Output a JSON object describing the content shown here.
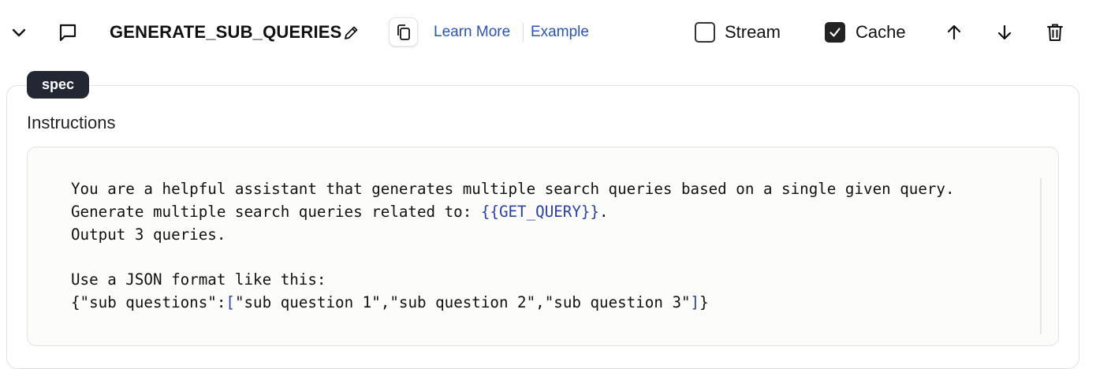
{
  "toolbar": {
    "title": "GENERATE_SUB_QUERIES",
    "learn_more": "Learn More",
    "example": "Example",
    "stream": {
      "label": "Stream",
      "checked": false
    },
    "cache": {
      "label": "Cache",
      "checked": true
    }
  },
  "spec_badge": "spec",
  "instructions": {
    "label": "Instructions",
    "lines": [
      {
        "parts": [
          {
            "text": "You are a helpful assistant that generates multiple search queries based on a single given query.",
            "kind": "plain"
          }
        ]
      },
      {
        "parts": [
          {
            "text": "Generate multiple search queries related to: ",
            "kind": "plain"
          },
          {
            "text": "{{GET_QUERY}}",
            "kind": "var"
          },
          {
            "text": ".",
            "kind": "plain"
          }
        ]
      },
      {
        "parts": [
          {
            "text": "Output 3 queries.",
            "kind": "plain"
          }
        ]
      },
      {
        "parts": [
          {
            "text": "",
            "kind": "plain"
          }
        ]
      },
      {
        "parts": [
          {
            "text": "Use a JSON format like this:",
            "kind": "plain"
          }
        ]
      },
      {
        "parts": [
          {
            "text": "{\"sub questions\":",
            "kind": "plain"
          },
          {
            "text": "[",
            "kind": "br"
          },
          {
            "text": "\"sub question 1\",\"sub question 2\",\"sub question 3\"",
            "kind": "plain"
          },
          {
            "text": "]",
            "kind": "br"
          },
          {
            "text": "}",
            "kind": "plain"
          }
        ]
      }
    ]
  }
}
